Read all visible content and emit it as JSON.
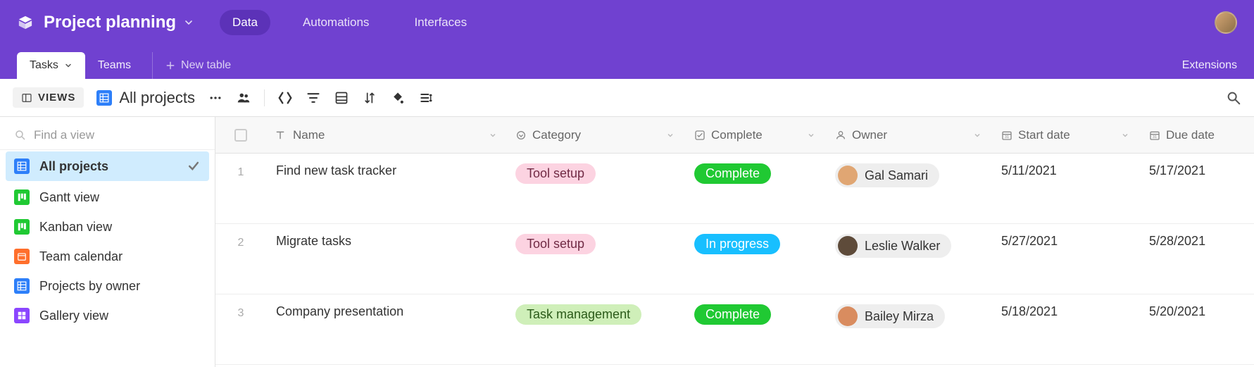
{
  "header": {
    "title": "Project planning",
    "nav": {
      "data": "Data",
      "automations": "Automations",
      "interfaces": "Interfaces"
    }
  },
  "tablebar": {
    "tabs": [
      {
        "label": "Tasks"
      },
      {
        "label": "Teams"
      }
    ],
    "new_table": "New table",
    "extensions": "Extensions"
  },
  "toolbar": {
    "views_label": "VIEWS",
    "view_title": "All projects"
  },
  "sidebar": {
    "find_placeholder": "Find a view",
    "views": [
      {
        "label": "All projects",
        "icon_bg": "#2d7ff9",
        "active": true
      },
      {
        "label": "Gantt view",
        "icon_bg": "#20c933"
      },
      {
        "label": "Kanban view",
        "icon_bg": "#20c933"
      },
      {
        "label": "Team calendar",
        "icon_bg": "#ff6f2c"
      },
      {
        "label": "Projects by owner",
        "icon_bg": "#2d7ff9"
      },
      {
        "label": "Gallery view",
        "icon_bg": "#8b46ff"
      }
    ]
  },
  "columns": {
    "name": "Name",
    "category": "Category",
    "complete": "Complete",
    "owner": "Owner",
    "start_date": "Start date",
    "due_date": "Due date"
  },
  "rows": [
    {
      "num": "1",
      "name": "Find new task tracker",
      "category": "Tool setup",
      "cat_cls": "pill-toolsetup",
      "status": "Complete",
      "status_cls": "pill-complete",
      "owner": "Gal Samari",
      "owner_bg": "#e0a673",
      "start": "5/11/2021",
      "due": "5/17/2021"
    },
    {
      "num": "2",
      "name": "Migrate tasks",
      "category": "Tool setup",
      "cat_cls": "pill-toolsetup",
      "status": "In progress",
      "status_cls": "pill-progress",
      "owner": "Leslie Walker",
      "owner_bg": "#5e4b3a",
      "start": "5/27/2021",
      "due": "5/28/2021"
    },
    {
      "num": "3",
      "name": "Company presentation",
      "category": "Task management",
      "cat_cls": "pill-taskmgmt",
      "status": "Complete",
      "status_cls": "pill-complete",
      "owner": "Bailey Mirza",
      "owner_bg": "#d98c5f",
      "start": "5/18/2021",
      "due": "5/20/2021"
    }
  ]
}
